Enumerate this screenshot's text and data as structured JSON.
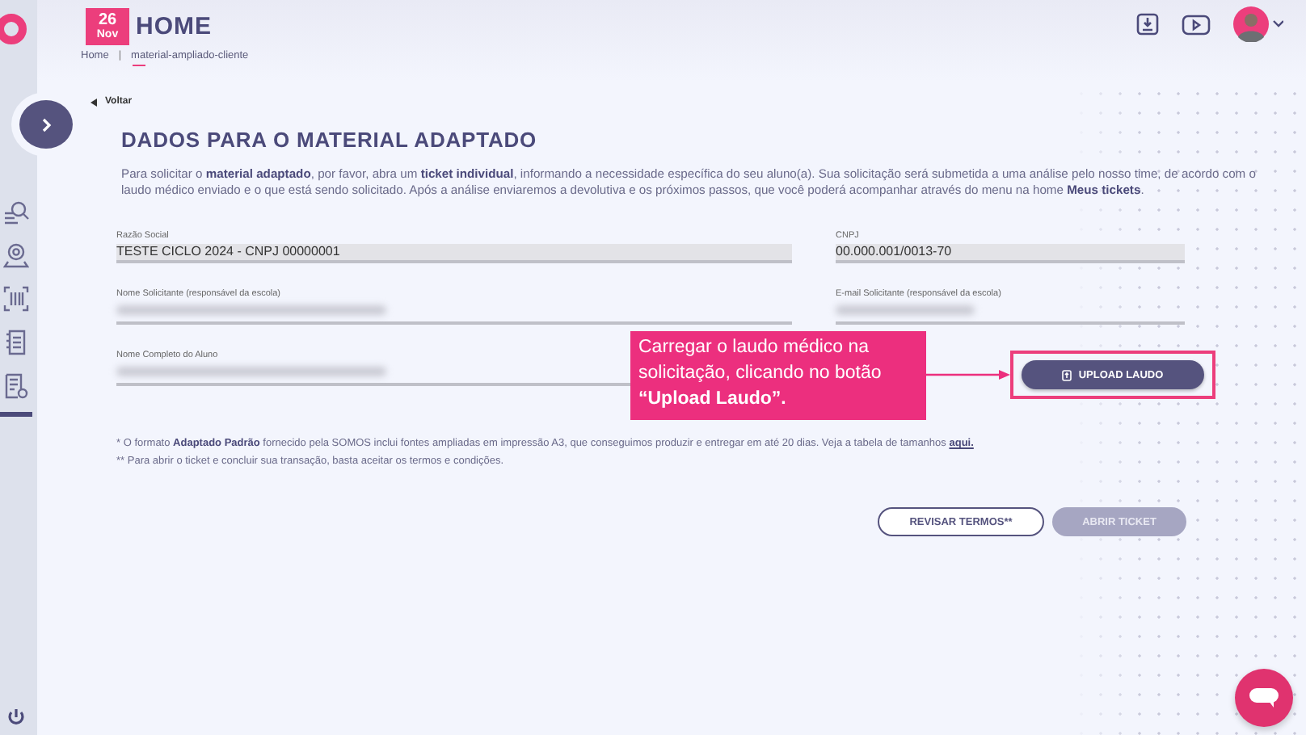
{
  "header": {
    "date_day": "26",
    "date_month": "Nov",
    "title": "HOME"
  },
  "breadcrumb_separator": "|",
  "breadcrumb": [
    {
      "label": "Home",
      "selected": false
    },
    {
      "label": "material-ampliado-cliente",
      "selected": true
    }
  ],
  "back_link": "Voltar",
  "title": "DADOS PARA O MATERIAL ADAPTADO",
  "intro": "Para solicitar o **material adaptado**, por favor, abra um **ticket individual**, informando a necessidade específica do seu aluno(a). Sua solicitação será submetida a uma análise pelo nosso time, de acordo com o laudo médico enviado e o que está sendo solicitado. Após a análise enviaremos a devolutiva e os próximos passos, que você poderá acompanhar através do menu na home **Meus tickets**.",
  "fields": [
    {
      "label": "Razão Social",
      "value": "TESTE CICLO 2024 - CNPJ 00000001",
      "kind": "filled"
    },
    {
      "label": "CNPJ",
      "value": "00.000.001/0013-70",
      "kind": "filled"
    },
    {
      "label": "Nome Solicitante (responsável da escola)",
      "kind": "blurred"
    },
    {
      "label": "E-mail Solicitante (responsável da escola)",
      "kind": "blurred"
    },
    {
      "label": "Nome Completo do Aluno",
      "kind": "blurred"
    }
  ],
  "upload_button": "UPLOAD LAUDO",
  "callout": "Carregar o laudo médico na solicitação, clicando no botão **“Upload Laudo”.**",
  "notes": [
    {
      "text": "* O formato **Adaptado Padrão** fornecido pela SOMOS inclui fontes ampliadas em impressão A3, que conseguimos produzir e entregar em até 20 dias. Veja a tabela de tamanhos",
      "link": "aqui."
    },
    {
      "text": "** Para abrir o ticket e concluir sua transação, basta aceitar os termos e condições."
    }
  ],
  "buttons": [
    {
      "label": "REVISAR TERMOS**",
      "kind": "outline",
      "disabled": false
    },
    {
      "label": "ABRIR TICKET",
      "kind": "primary",
      "disabled": true
    }
  ]
}
